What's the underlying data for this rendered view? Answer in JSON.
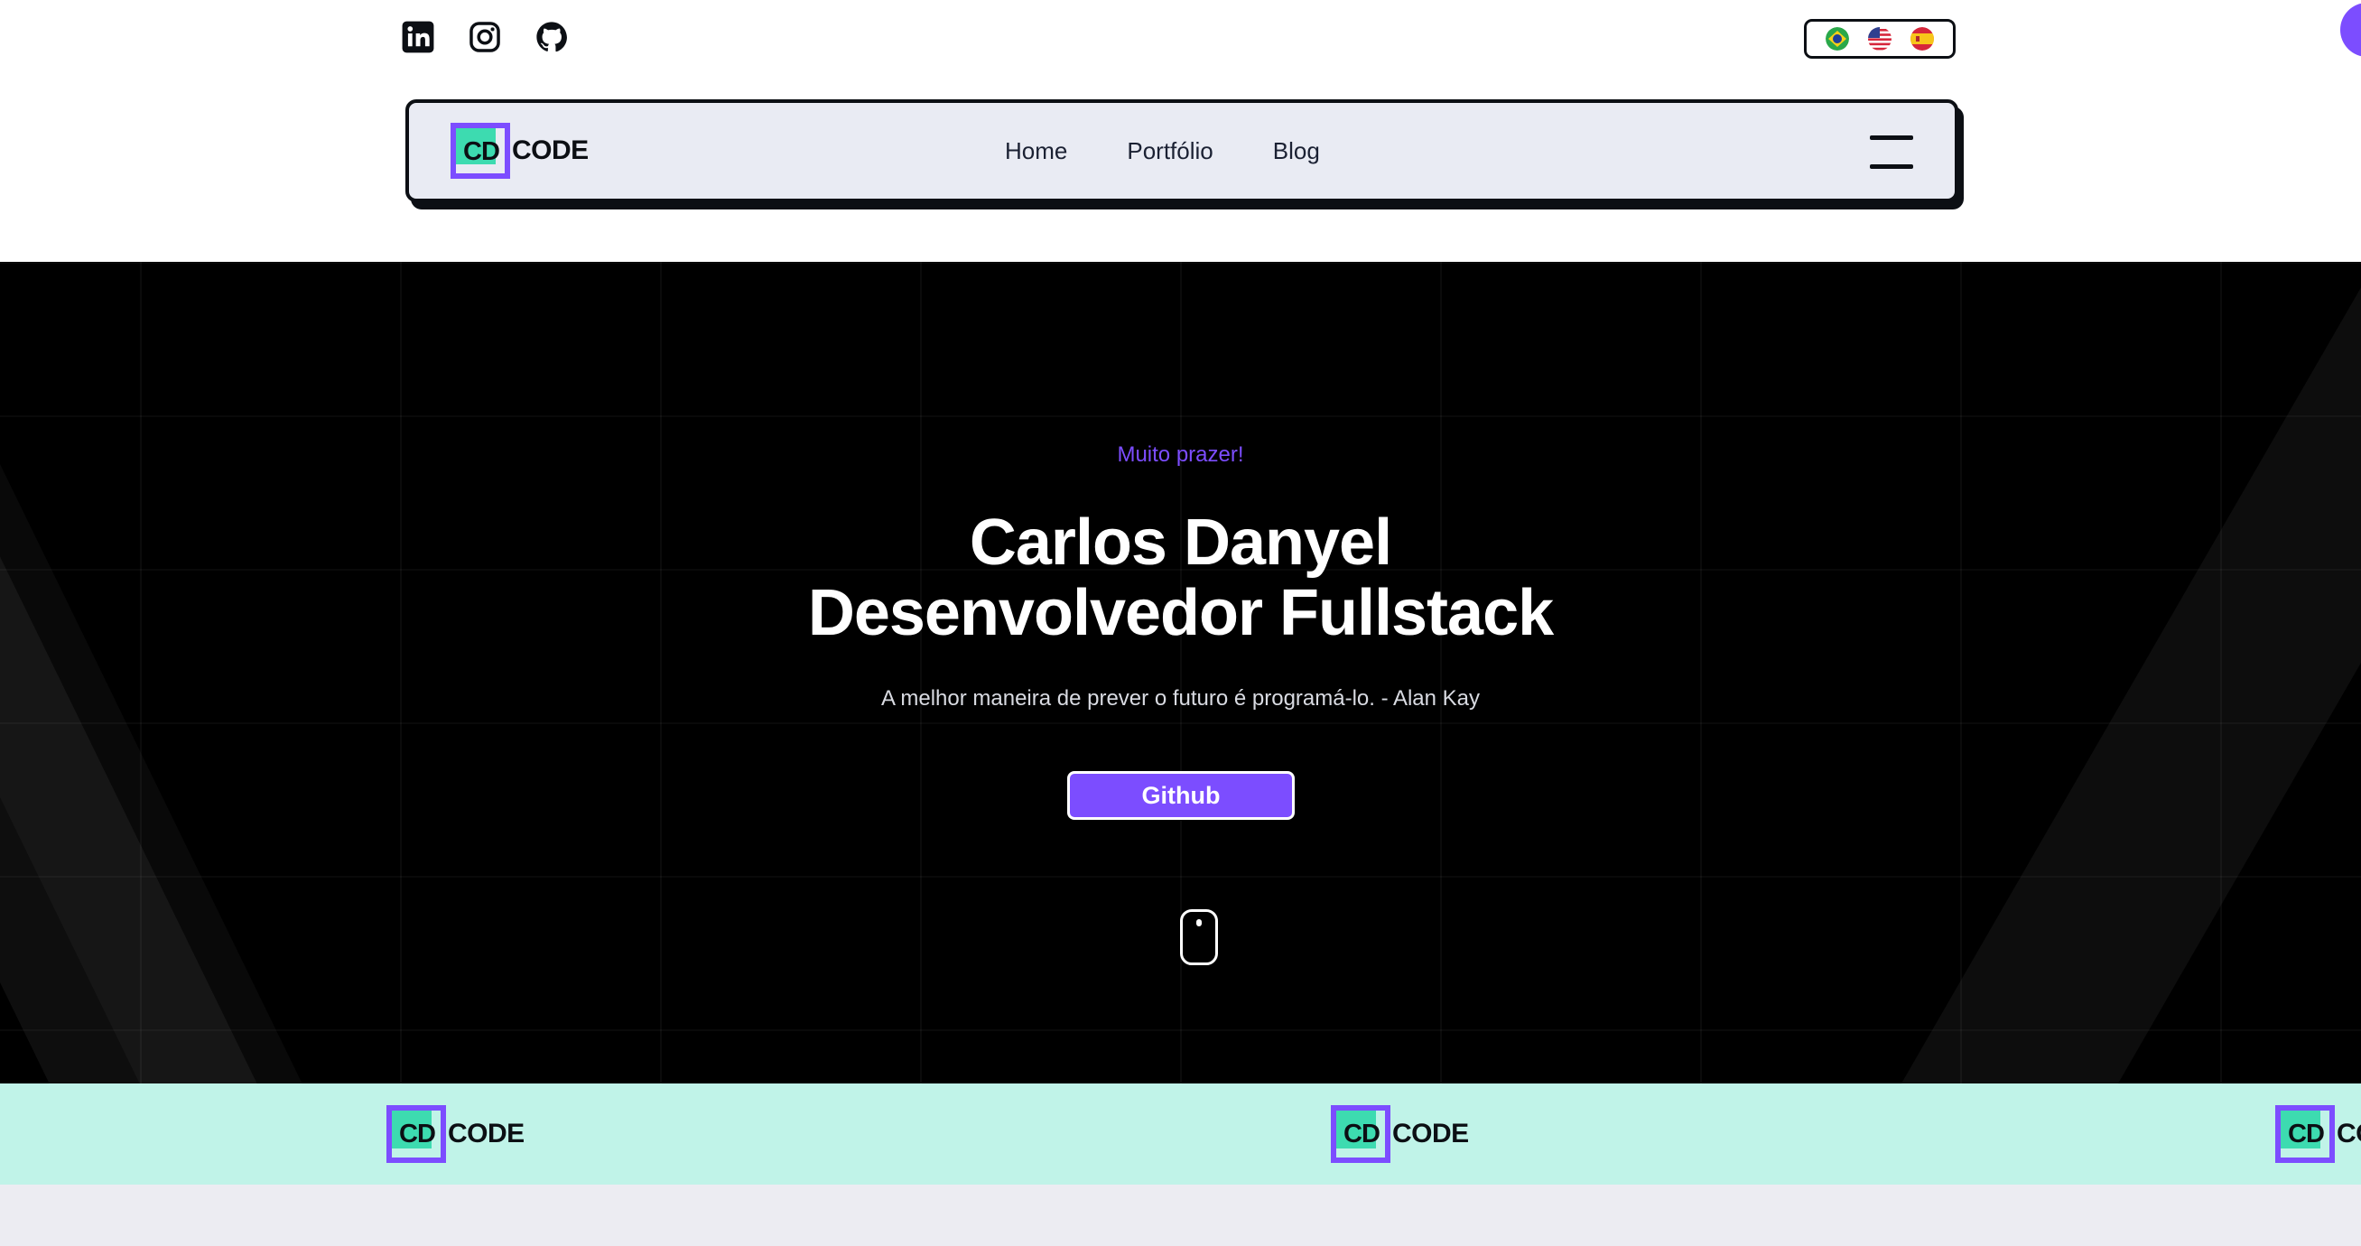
{
  "social": {
    "items": [
      {
        "icon": "linkedin-icon"
      },
      {
        "icon": "instagram-icon"
      },
      {
        "icon": "github-icon"
      }
    ]
  },
  "languages": [
    {
      "icon": "brazil-flag-icon"
    },
    {
      "icon": "usa-flag-icon"
    },
    {
      "icon": "spain-flag-icon"
    }
  ],
  "brand": {
    "mark": "CD",
    "word": "CODE"
  },
  "nav": {
    "links": [
      "Home",
      "Portfólio",
      "Blog"
    ],
    "menu_icon": "hamburger-menu-icon"
  },
  "hero": {
    "kicker": "Muito prazer!",
    "title_line1": "Carlos Danyel",
    "title_line2": "Desenvolvedor Fullstack",
    "quote": "A melhor maneira de prever o futuro é programá-lo. - Alan Kay",
    "button": "Github",
    "scroll_icon": "mouse-scroll-icon"
  },
  "marquee": {
    "items": [
      {
        "mark": "CD",
        "word": "CODE"
      },
      {
        "mark": "CD",
        "word": "CODE"
      },
      {
        "mark": "CD",
        "word": "CODE"
      }
    ]
  },
  "colors": {
    "accent": "#7c4dff",
    "teal": "#3ddbb0",
    "marquee_bg": "#c0f3e8",
    "nav_bg": "#e9ebf3"
  }
}
